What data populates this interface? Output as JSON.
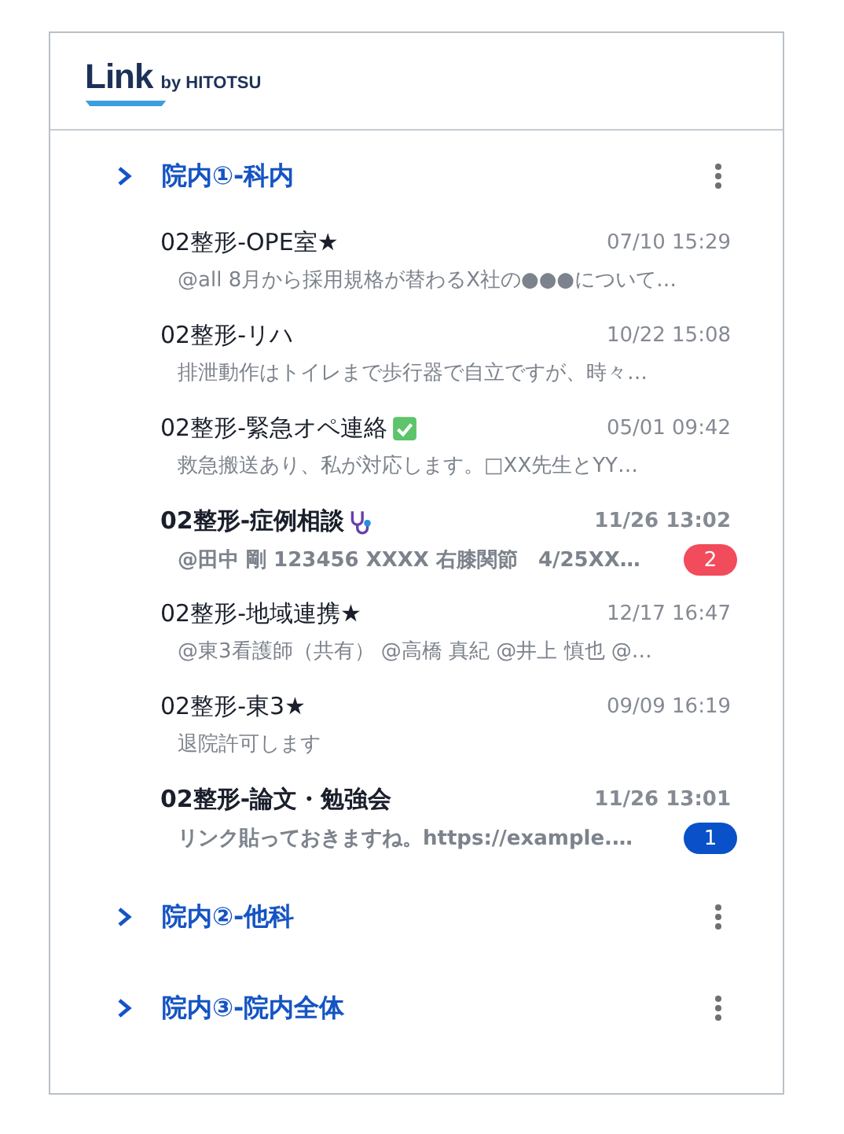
{
  "logo": {
    "name": "Link",
    "byline": "by HITOTSU"
  },
  "groups": [
    {
      "label": "院内①-科内",
      "channels": [
        {
          "name": "02整形-OPE室★",
          "time": "07/10 15:29",
          "preview": "@all 8月から採用規格が替わるX社の●●●について…",
          "unread": false
        },
        {
          "name": "02整形-リハ",
          "time": "10/22 15:08",
          "preview": "排泄動作はトイレまで歩行器で自立ですが、時々…",
          "unread": false
        },
        {
          "name": "02整形-緊急オペ連絡",
          "kind": "check",
          "time": "05/01 09:42",
          "preview": "救急搬送あり、私が対応します。□XX先生とYY…",
          "unread": false
        },
        {
          "name": "02整形-症例相談",
          "kind": "stethoscope",
          "time": "11/26 13:02",
          "preview": "@田中 剛 123456 XXXX 右膝関節　4/25XX…",
          "unread": true,
          "badge": "2",
          "color": "#f24b5b"
        },
        {
          "name": "02整形-地域連携★",
          "time": "12/17 16:47",
          "preview": "@東3看護師（共有） @高橋 真紀 @井上 慎也 @…",
          "unread": false
        },
        {
          "name": "02整形-東3★",
          "time": "09/09 16:19",
          "preview": "退院許可します",
          "unread": false
        },
        {
          "name": "02整形-論文・勉強会",
          "time": "11/26 13:01",
          "preview": "リンク貼っておきますね。https://example.…",
          "unread": true,
          "badge": "1",
          "color": "#0a50c8"
        }
      ]
    },
    {
      "label": "院内②-他科"
    },
    {
      "label": "院内③-院内全体"
    }
  ]
}
